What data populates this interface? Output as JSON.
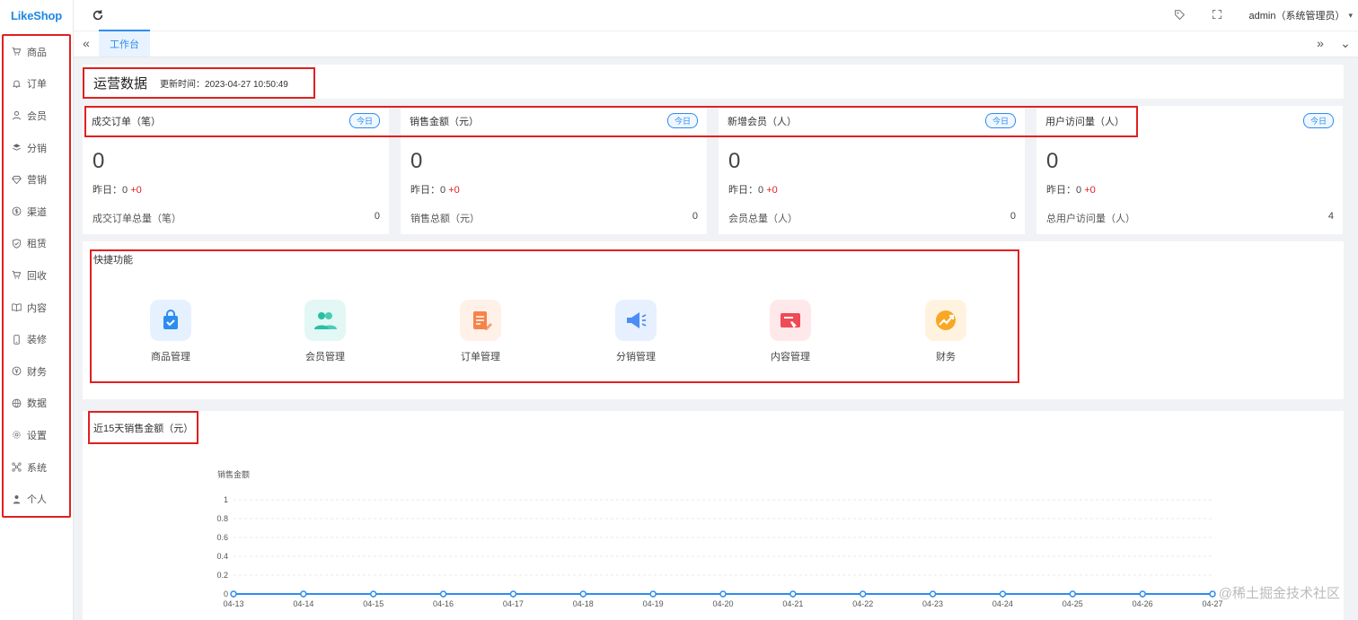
{
  "app": {
    "logo": "LikeShop"
  },
  "sidebar": {
    "items": [
      {
        "label": "商品",
        "icon": "cart-icon"
      },
      {
        "label": "订单",
        "icon": "bell-icon"
      },
      {
        "label": "会员",
        "icon": "user-icon"
      },
      {
        "label": "分销",
        "icon": "layers-icon"
      },
      {
        "label": "营销",
        "icon": "diamond-icon"
      },
      {
        "label": "渠道",
        "icon": "dollar-icon"
      },
      {
        "label": "租赁",
        "icon": "shield-icon"
      },
      {
        "label": "回收",
        "icon": "recycle-cart-icon"
      },
      {
        "label": "内容",
        "icon": "book-icon"
      },
      {
        "label": "装修",
        "icon": "phone-icon"
      },
      {
        "label": "财务",
        "icon": "yen-icon"
      },
      {
        "label": "数据",
        "icon": "globe-icon"
      },
      {
        "label": "设置",
        "icon": "gear-icon"
      },
      {
        "label": "系统",
        "icon": "network-icon"
      },
      {
        "label": "个人",
        "icon": "person-icon"
      }
    ]
  },
  "header": {
    "user": "admin（系统管理员）"
  },
  "tabs": [
    {
      "label": "工作台",
      "active": true
    }
  ],
  "ops": {
    "title": "运营数据",
    "update_label": "更新时间：",
    "update_time": "2023-04-27 10:50:49"
  },
  "stats": [
    {
      "label": "成交订单（笔）",
      "badge": "今日",
      "value": "0",
      "yesterday_label": "昨日：",
      "yesterday_value": "0",
      "yesterday_change": "+0",
      "total_label": "成交订单总量（笔）",
      "total": "0"
    },
    {
      "label": "销售金额（元）",
      "badge": "今日",
      "value": "0",
      "yesterday_label": "昨日：",
      "yesterday_value": "0",
      "yesterday_change": "+0",
      "total_label": "销售总额（元）",
      "total": "0"
    },
    {
      "label": "新增会员（人）",
      "badge": "今日",
      "value": "0",
      "yesterday_label": "昨日：",
      "yesterday_value": "0",
      "yesterday_change": "+0",
      "total_label": "会员总量（人）",
      "total": "0"
    },
    {
      "label": "用户访问量（人）",
      "badge": "今日",
      "value": "0",
      "yesterday_label": "昨日：",
      "yesterday_value": "0",
      "yesterday_change": "+0",
      "total_label": "总用户访问量（人）",
      "total": "4"
    }
  ],
  "quick": {
    "title": "快捷功能",
    "items": [
      {
        "label": "商品管理",
        "icon": "shopping-bag-icon",
        "bg": "#e6f1ff",
        "color": "#2d8cf0"
      },
      {
        "label": "会员管理",
        "icon": "members-icon",
        "bg": "#e3f7f4",
        "color": "#26c0a4"
      },
      {
        "label": "订单管理",
        "icon": "order-icon",
        "bg": "#fff0e8",
        "color": "#f5844c"
      },
      {
        "label": "分销管理",
        "icon": "megaphone-icon",
        "bg": "#e6f0ff",
        "color": "#4b8cf5"
      },
      {
        "label": "内容管理",
        "icon": "content-icon",
        "bg": "#ffe8ea",
        "color": "#ef4a56"
      },
      {
        "label": "财务",
        "icon": "finance-icon",
        "bg": "#fff3e0",
        "color": "#f9a825"
      }
    ]
  },
  "chart_data": {
    "type": "line",
    "title": "近15天销售金额（元）",
    "ylabel": "销售金额",
    "x": [
      "04-13",
      "04-14",
      "04-15",
      "04-16",
      "04-17",
      "04-18",
      "04-19",
      "04-20",
      "04-21",
      "04-22",
      "04-23",
      "04-24",
      "04-25",
      "04-26",
      "04-27"
    ],
    "series": [
      {
        "values": [
          0,
          0,
          0,
          0,
          0,
          0,
          0,
          0,
          0,
          0,
          0,
          0,
          0,
          0,
          0
        ]
      }
    ],
    "y_ticks": [
      "0",
      "0.2",
      "0.4",
      "0.6",
      "0.8",
      "1"
    ],
    "ylim": [
      0,
      1
    ],
    "color": "#2d8cf0"
  },
  "watermark": "@稀土掘金技术社区"
}
